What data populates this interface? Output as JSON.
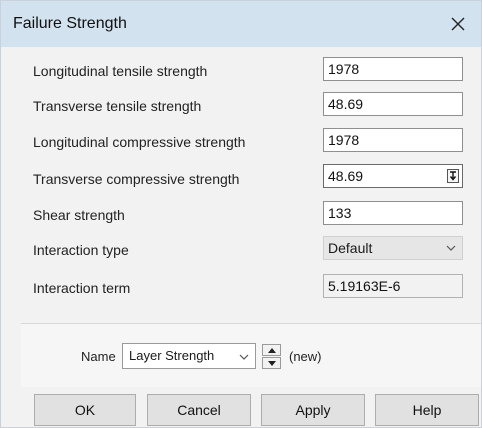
{
  "window": {
    "title": "Failure Strength"
  },
  "fields": [
    {
      "label": "Longitudinal tensile strength",
      "value": "1978"
    },
    {
      "label": "Transverse tensile strength",
      "value": "48.69"
    },
    {
      "label": "Longitudinal compressive strength",
      "value": "1978"
    },
    {
      "label": "Transverse compressive strength",
      "value": "48.69"
    },
    {
      "label": "Shear strength",
      "value": "133"
    }
  ],
  "interaction_type": {
    "label": "Interaction type",
    "value": "Default"
  },
  "interaction_term": {
    "label": "Interaction term",
    "value": "5.19163E-6"
  },
  "name_row": {
    "label": "Name",
    "value": "Layer Strength",
    "suffix": "(new)"
  },
  "buttons": {
    "ok": "OK",
    "cancel": "Cancel",
    "apply": "Apply",
    "help": "Help"
  },
  "icons": {
    "close": "close-icon",
    "dropdown": "chevron-down-icon",
    "spin_up": "spin-up-icon",
    "spin_down": "spin-down-icon",
    "field_spin": "spin-marker-icon"
  }
}
